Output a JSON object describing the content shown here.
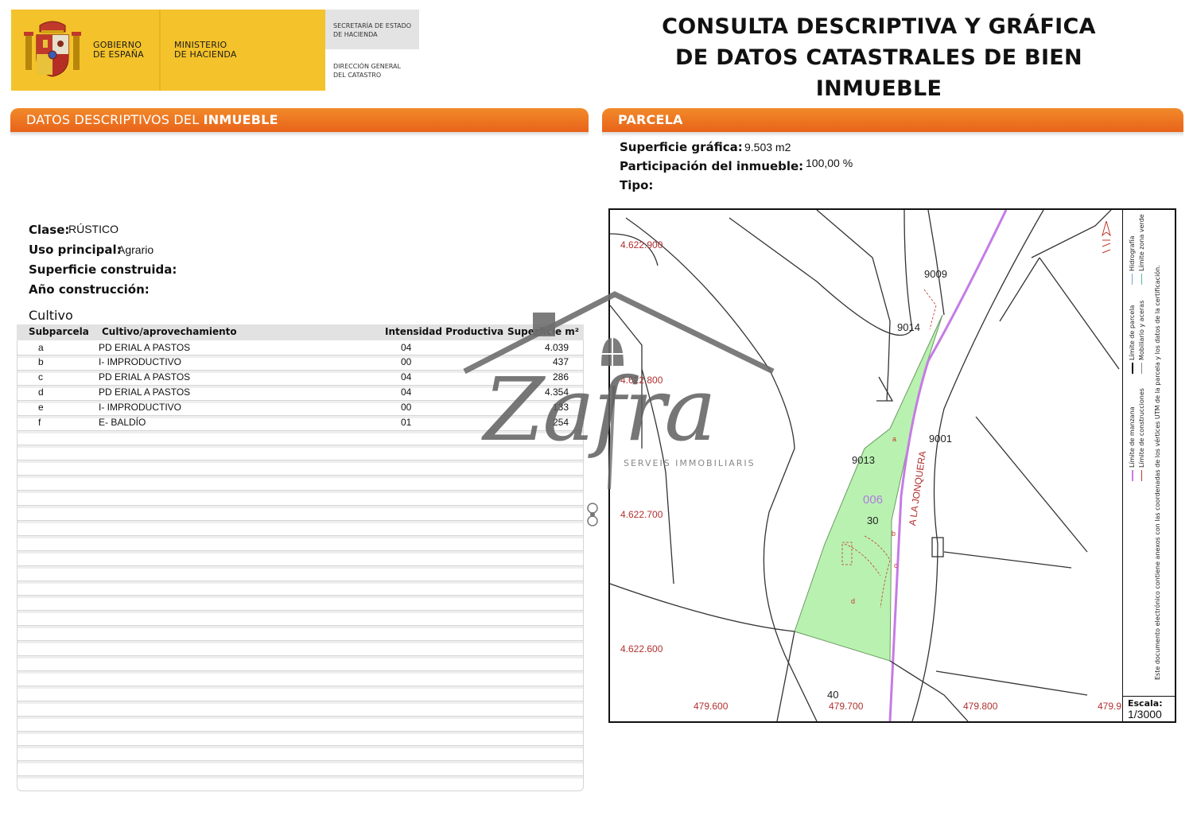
{
  "header": {
    "gov_line1": "GOBIERNO",
    "gov_line2": "DE ESPAÑA",
    "ministry_line1": "MINISTERIO",
    "ministry_line2": "DE HACIENDA",
    "secretary_line1": "SECRETARÍA DE ESTADO",
    "secretary_line2": "DE HACIENDA",
    "direction_line1": "DIRECCIÓN GENERAL",
    "direction_line2": "DEL CATASTRO",
    "title_line1": "CONSULTA DESCRIPTIVA Y GRÁFICA",
    "title_line2": "DE DATOS CATASTRALES DE BIEN INMUEBLE"
  },
  "descriptive": {
    "bar_title_normal": "DATOS DESCRIPTIVOS DEL ",
    "bar_title_bold": "INMUEBLE",
    "clase_label": "Clase:",
    "clase_value": "RÚSTICO",
    "uso_label": "Uso principal:",
    "uso_value": "Agrario",
    "superficie_label": "Superficie construida:",
    "anio_label": "Año construcción:"
  },
  "cultivo": {
    "title": "Cultivo",
    "headers": [
      "Subparcela",
      "Cultivo/aprovechamiento",
      "Intensidad Productiva",
      "Superficie m²"
    ],
    "rows": [
      [
        "a",
        "PD ERIAL A PASTOS",
        "04",
        "4.039"
      ],
      [
        "b",
        "I- IMPRODUCTIVO",
        "00",
        "437"
      ],
      [
        "c",
        "PD ERIAL A PASTOS",
        "04",
        "286"
      ],
      [
        "d",
        "PD ERIAL A PASTOS",
        "04",
        "4.354"
      ],
      [
        "e",
        "I- IMPRODUCTIVO",
        "00",
        "133"
      ],
      [
        "f",
        "E- BALDÍO",
        "01",
        "254"
      ]
    ]
  },
  "parcela": {
    "bar_title": "PARCELA",
    "sup_label": "Superficie gráfica:",
    "sup_value": "9.503 m2",
    "part_label": "Participación del inmueble:",
    "part_value": "100,00 %",
    "tipo_label": "Tipo:"
  },
  "map": {
    "y_ticks": [
      "4.622.900",
      "4.622.800",
      "4.622.700",
      "4.622.600"
    ],
    "x_ticks": [
      "479.600",
      "479.700",
      "479.800",
      "479.9"
    ],
    "parcel_ids": [
      "9009",
      "9014",
      "9013",
      "9001",
      "30",
      "40"
    ],
    "parcel_code": "006",
    "road_name": "A LA JONQUERA",
    "subparcel_marks": [
      "a",
      "b",
      "c",
      "d"
    ],
    "scale_label": "Escala:",
    "scale_value": "1/3000",
    "legend": [
      "Límite de manzana",
      "Límite de parcela",
      "Hidrografía",
      "Límite de construcciones",
      "Mobiliario y aceras",
      "Límite zona verde"
    ],
    "legend_note": "Este documento electrónico contiene anexos con las coordenadas de los vértices UTM de la parcela y los datos de la certificación."
  },
  "watermark": {
    "brand": "Zafra",
    "tagline": "SERVEIS IMMOBILIARIS"
  },
  "colors": {
    "orange": "#ec6f1f",
    "gov_yellow": "#f4c22a",
    "parcel_green": "#b9f2b0",
    "road_purple": "#c57be6",
    "coord_red": "#b0302f"
  }
}
